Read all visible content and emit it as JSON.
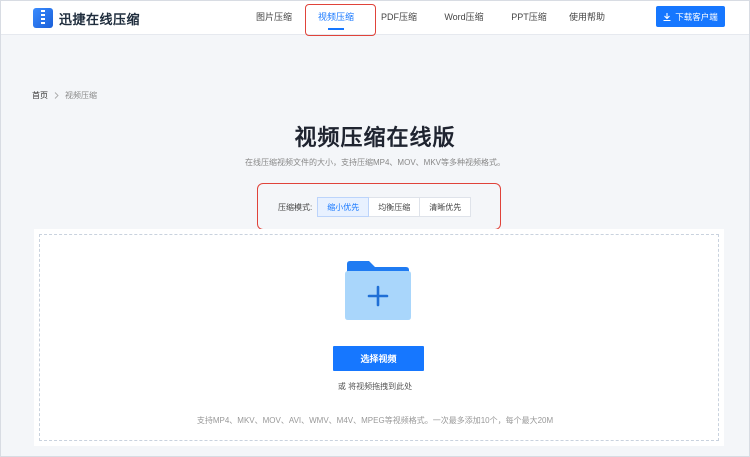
{
  "header": {
    "brand": "迅捷在线压缩",
    "nav": [
      {
        "label": "图片压缩",
        "active": false
      },
      {
        "label": "视频压缩",
        "active": true
      },
      {
        "label": "PDF压缩",
        "active": false
      },
      {
        "label": "Word压缩",
        "active": false
      },
      {
        "label": "PPT压缩",
        "active": false
      },
      {
        "label": "使用帮助",
        "active": false
      }
    ],
    "download_label": "下载客户端"
  },
  "breadcrumb": {
    "home": "首页",
    "current": "视频压缩"
  },
  "main": {
    "title": "视频压缩在线版",
    "subtitle": "在线压缩视频文件的大小，支持压缩MP4、MOV、MKV等多种视频格式。"
  },
  "mode": {
    "label": "压缩模式:",
    "options": [
      "缩小优先",
      "均衡压缩",
      "清晰优先"
    ],
    "selected_index": 0
  },
  "upload": {
    "button_label": "选择视频",
    "drag_hint": "或 将视频拖拽到此处",
    "formats_text": "支持MP4、MKV、MOV、AVI、WMV、M4V、MPEG等视频格式。一次最多添加10个，每个最大20M"
  },
  "colors": {
    "accent": "#1677ff",
    "highlight_border": "#e0433a"
  }
}
